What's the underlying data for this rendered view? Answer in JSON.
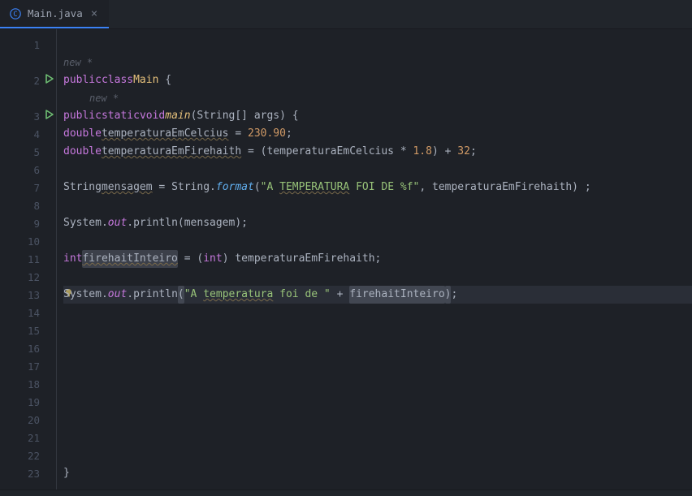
{
  "tab": {
    "label": "Main.java",
    "close": "×"
  },
  "hints": {
    "new1": "new *",
    "new2": "new *"
  },
  "code": {
    "l2_public": "public",
    "l2_class": "class",
    "l2_name": "Main",
    "l2_brace": " {",
    "l3_public": "public",
    "l3_static": "static",
    "l3_void": "void",
    "l3_main": "main",
    "l3_sig": "(String[] args) {",
    "l4_type": "double",
    "l4_var": "temperaturaEmCelcius",
    "l4_eq": " = ",
    "l4_val": "230.90",
    "l4_semi": ";",
    "l5_type": "double",
    "l5_var": "temperaturaEmFirehaith",
    "l5_eq": " = (temperaturaEmCelcius * ",
    "l5_v1": "1.8",
    "l5_mid": ") + ",
    "l5_v2": "32",
    "l5_semi": ";",
    "l7_type": "String",
    "l7_var": "mensagem",
    "l7_eq": " = String.",
    "l7_fmt": "format",
    "l7_open": "(",
    "l7_s1": "\"A ",
    "l7_s2": "TEMPERATURA",
    "l7_s3": " FOI DE %f\"",
    "l7_rest": ", temperaturaEmFirehaith) ;",
    "l9_sys": "System.",
    "l9_out": "out",
    "l9_pln": ".println(mensagem);",
    "l11_type": "int",
    "l11_var": "firehaitInteiro",
    "l11_eq": " = (",
    "l11_cast": "int",
    "l11_rest": ") temperaturaEmFirehaith;",
    "l13_sys": "System.",
    "l13_out": "out",
    "l13_pln1": ".println",
    "l13_po": "(",
    "l13_s1": "\"A ",
    "l13_s2": "temperatura",
    "l13_s3": " foi de \"",
    "l13_plus": " + ",
    "l13_var": "firehaitInteiro",
    "l13_pc": ")",
    "l13_semi": ";",
    "l23_brace": "}"
  },
  "lines": [
    "1",
    "2",
    "3",
    "4",
    "5",
    "6",
    "7",
    "8",
    "9",
    "10",
    "11",
    "12",
    "13",
    "14",
    "15",
    "16",
    "17",
    "18",
    "19",
    "20",
    "21",
    "22",
    "23"
  ],
  "colors": {
    "accent": "#3b82f6",
    "run": "#6fbf73",
    "bulb": "#e2c75b"
  }
}
